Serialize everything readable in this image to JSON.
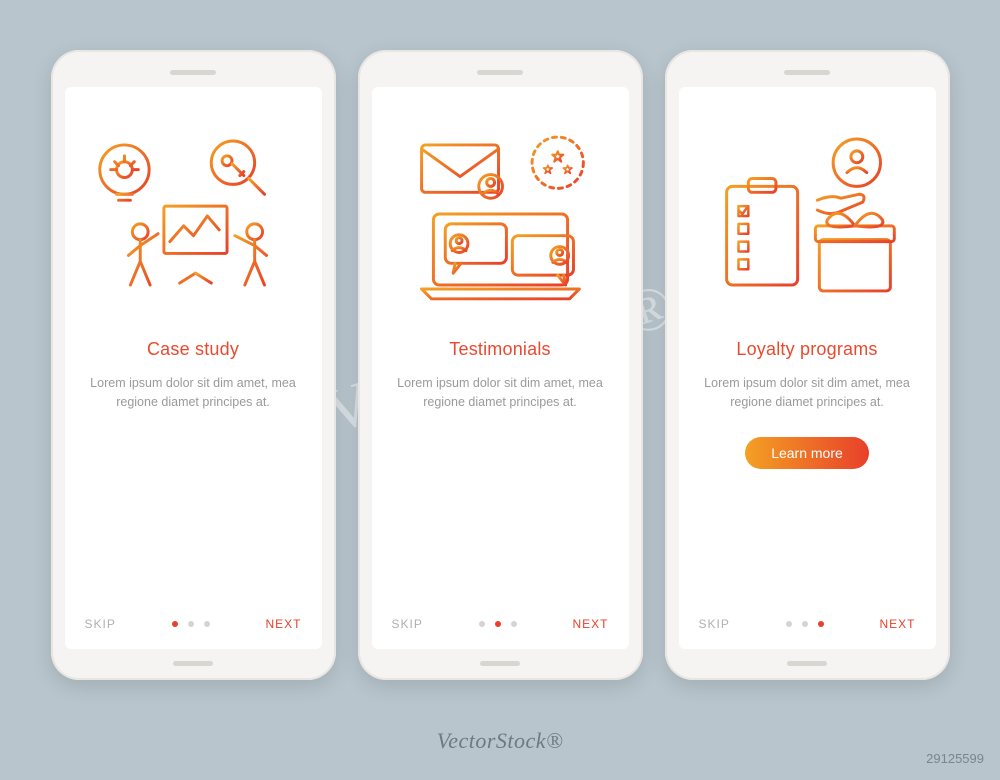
{
  "screens": [
    {
      "title": "Case study",
      "body": "Lorem ipsum dolor sit dim amet, mea regione diamet principes at.",
      "skip": "SKIP",
      "next": "NEXT",
      "activeDot": 0,
      "hasCta": false
    },
    {
      "title": "Testimonials",
      "body": "Lorem ipsum dolor sit dim amet, mea regione diamet principes at.",
      "skip": "SKIP",
      "next": "NEXT",
      "activeDot": 1,
      "hasCta": false
    },
    {
      "title": "Loyalty programs",
      "body": "Lorem ipsum dolor sit dim amet, mea regione diamet principes at.",
      "skip": "SKIP",
      "next": "NEXT",
      "activeDot": 2,
      "hasCta": true,
      "cta": "Learn more"
    }
  ],
  "watermark": {
    "text": "VectorStock®",
    "diagonal": "VectorStock®"
  },
  "imageId": "29125599",
  "colors": {
    "accent": "#e8402a",
    "gradientStart": "#f4a023",
    "gradientEnd": "#e8402a",
    "bg": "#b8c5cc"
  }
}
